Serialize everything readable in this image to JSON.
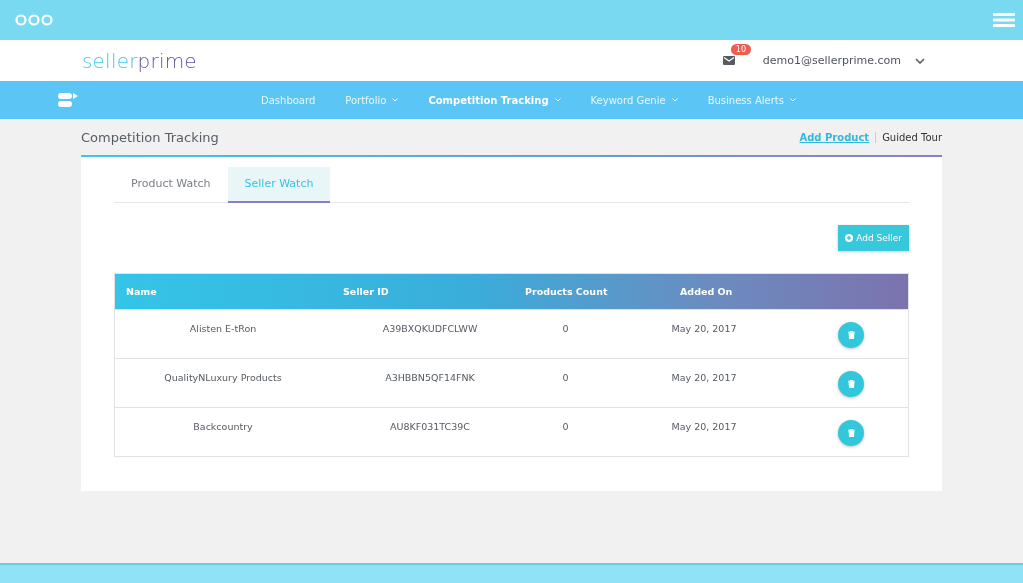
{
  "logo": {
    "part_1": "seller",
    "part_2": "prime"
  },
  "notifications": {
    "count": "10"
  },
  "user": {
    "email": "demo1@sellerprime.com"
  },
  "nav": [
    {
      "label": "Dashboard",
      "selected": false,
      "dropdown": false
    },
    {
      "label": "Portfolio",
      "selected": false,
      "dropdown": true
    },
    {
      "label": "Competition Tracking",
      "selected": true,
      "dropdown": true
    },
    {
      "label": "Keyword Genie",
      "selected": false,
      "dropdown": true
    },
    {
      "label": "Business Alerts",
      "selected": false,
      "dropdown": true
    }
  ],
  "page": {
    "title": "Competition Tracking",
    "links": [
      {
        "label": "Add Product",
        "selected": true
      },
      {
        "label": "Guided Tour",
        "selected": false
      }
    ]
  },
  "tabs": [
    {
      "label": "Product Watch",
      "selected": false
    },
    {
      "label": "Seller Watch",
      "selected": true
    }
  ],
  "add_button": {
    "label": "Add Seller"
  },
  "table": {
    "columns": [
      "Name",
      "Seller ID",
      "Products Count",
      "Added On"
    ],
    "rows": [
      {
        "name": "Alisten E-tRon",
        "seller_id": "A39BXQKUDFCLWW",
        "count": "0",
        "added": "May 20, 2017"
      },
      {
        "name": "QualityNLuxury Products",
        "seller_id": "A3HBBN5QF14FNK",
        "count": "0",
        "added": "May 20, 2017"
      },
      {
        "name": "Backcountry",
        "seller_id": "AU8KF031TC39C",
        "count": "0",
        "added": "May 20, 2017"
      }
    ]
  }
}
